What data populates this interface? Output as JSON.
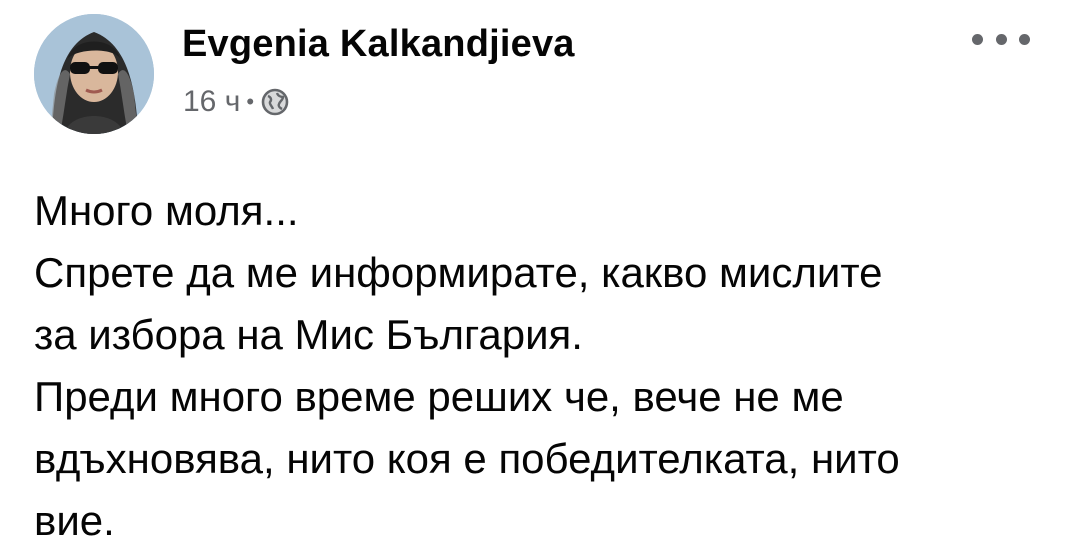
{
  "post": {
    "author_name": "Evgenia Kalkandjieva",
    "time_ago": "16 ч",
    "separator": "•",
    "privacy_icon": "globe-icon",
    "menu_icon": "more-dots-icon",
    "text_lines": [
      "Много моля...",
      "Спрете да ме информирате, какво мислите",
      "за избора на Мис България.",
      "Преди много време реших че, вече не ме",
      "вдъхновява, нито коя е победителката, нито",
      "вие."
    ]
  }
}
